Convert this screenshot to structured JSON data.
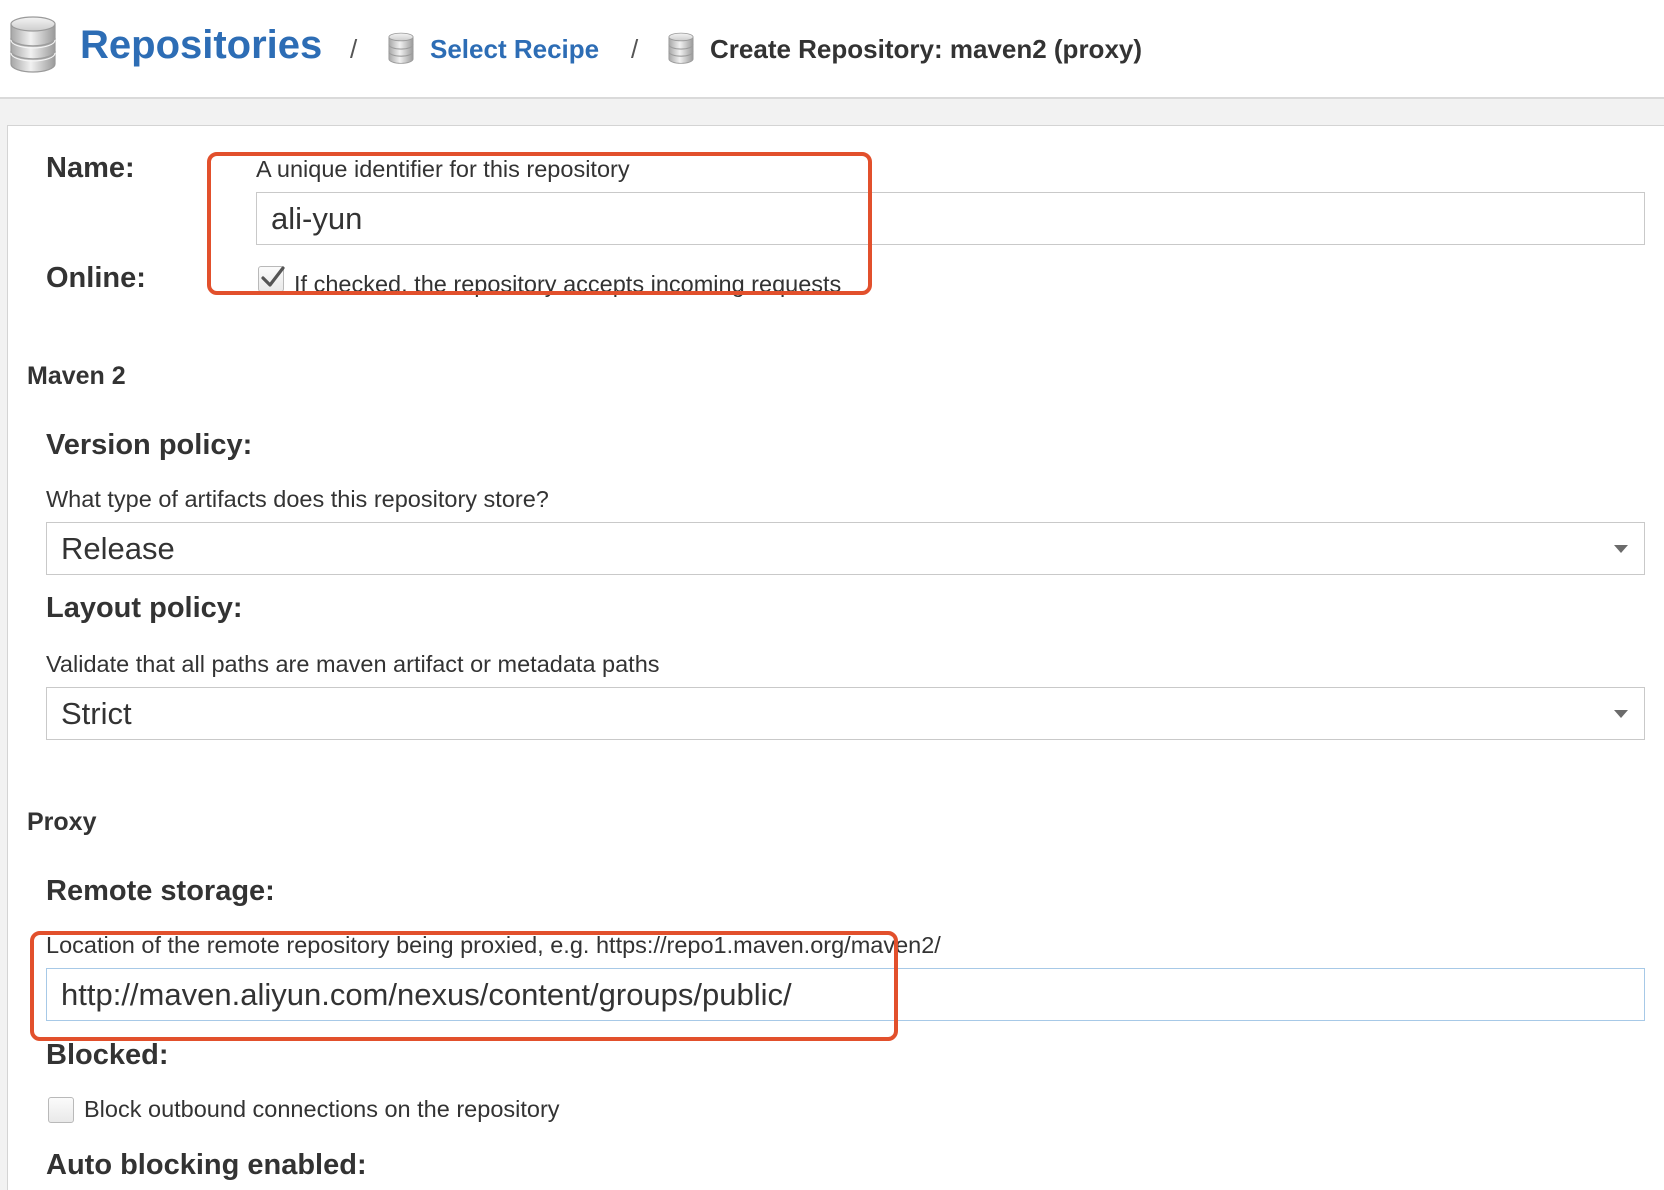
{
  "header": {
    "title": "Repositories",
    "title_icon": "database-icon",
    "separator": "/",
    "crumbs": [
      {
        "label": "Select Recipe",
        "icon": "database-icon"
      },
      {
        "label": "Create Repository: maven2 (proxy)",
        "icon": "database-icon"
      }
    ]
  },
  "form": {
    "name": {
      "label": "Name:",
      "help": "A unique identifier for this repository",
      "value": "ali-yun"
    },
    "online": {
      "label": "Online:",
      "checked": true,
      "help": "If checked, the repository accepts incoming requests"
    },
    "maven2": {
      "heading": "Maven 2",
      "version_policy": {
        "label": "Version policy:",
        "help": "What type of artifacts does this repository store?",
        "value": "Release",
        "icon": "caret-down-icon"
      },
      "layout_policy": {
        "label": "Layout policy:",
        "help": "Validate that all paths are maven artifact or metadata paths",
        "value": "Strict",
        "icon": "caret-down-icon"
      }
    },
    "proxy": {
      "heading": "Proxy",
      "remote_storage": {
        "label": "Remote storage:",
        "help": "Location of the remote repository being proxied, e.g. https://repo1.maven.org/maven2/",
        "value": "http://maven.aliyun.com/nexus/content/groups/public/"
      },
      "blocked": {
        "label": "Blocked:",
        "checked": false,
        "help": "Block outbound connections on the repository"
      },
      "auto_blocking": {
        "label": "Auto blocking enabled:"
      }
    }
  },
  "colors": {
    "link": "#2d6db5",
    "text": "#333333",
    "annotation": "#e2502c",
    "focused_border": "#a7c9e7"
  }
}
